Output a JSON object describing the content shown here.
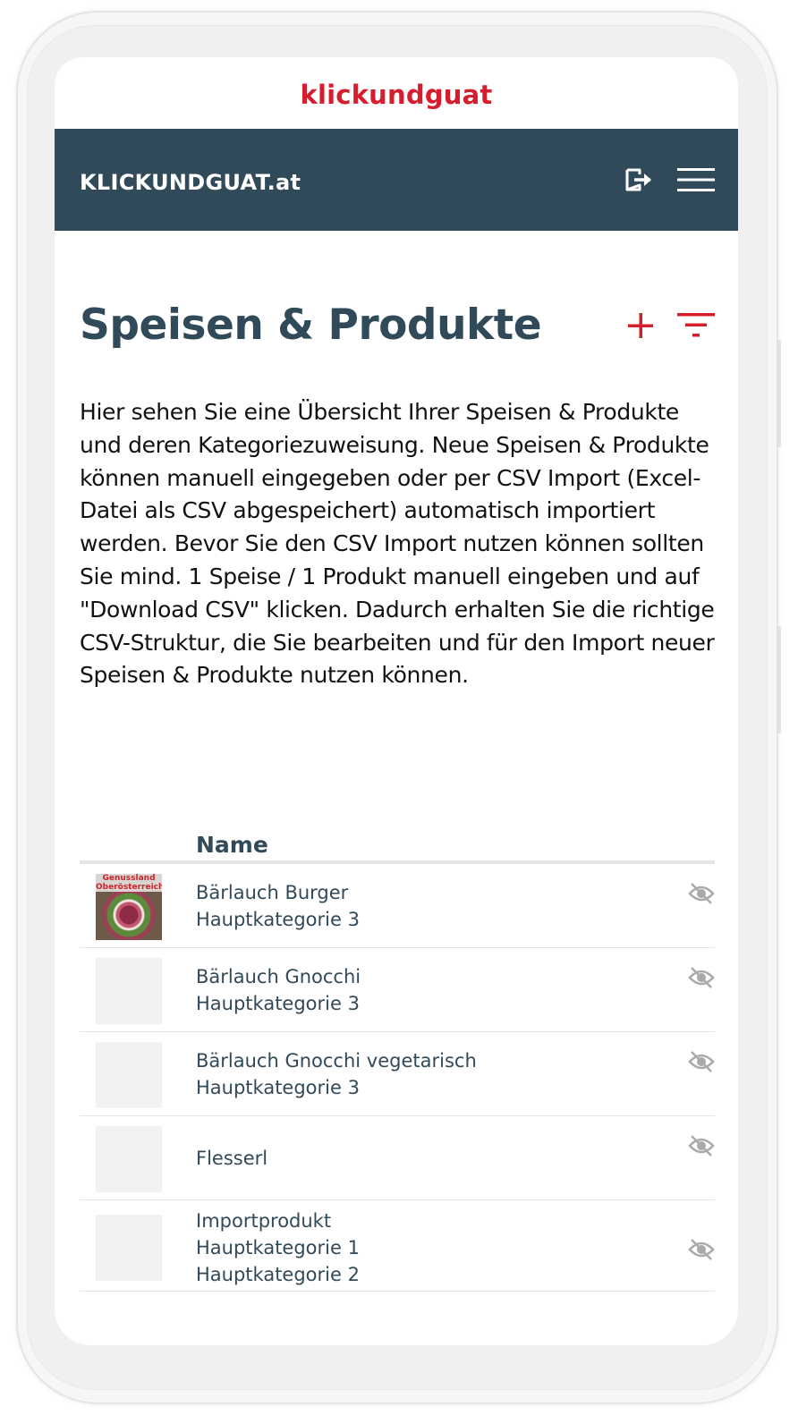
{
  "app": {
    "logo": "klickundguat",
    "brand": "KLICKUNDGUAT.at"
  },
  "header": {
    "icons": [
      "logout-icon",
      "hamburger-menu-icon"
    ]
  },
  "page": {
    "title": "Speisen & Produkte",
    "intro": "Hier sehen Sie eine Übersicht Ihrer Speisen & Produkte und deren Kategoriezuweisung. Neue Speisen & Produkte können manuell eingegeben oder per CSV Import (Excel-Datei als CSV abgespeichert) automatisch importiert werden. Bevor Sie den CSV Import nutzen können sollten Sie mind. 1 Speise / 1 Produkt manuell eingeben und auf \"Download CSV\" klicken. Dadurch erhalten Sie die richtige CSV-Struktur, die Sie bearbeiten und für den Import neuer Speisen & Produkte nutzen können."
  },
  "table": {
    "column_name": "Name",
    "rows": [
      {
        "name": "Bärlauch Burger",
        "categories": [
          "Hauptkategorie 3"
        ],
        "thumb_label": "Genussland Oberösterreich",
        "has_image": true
      },
      {
        "name": "Bärlauch Gnocchi",
        "categories": [
          "Hauptkategorie 3"
        ],
        "has_image": false
      },
      {
        "name": "Bärlauch Gnocchi vegetarisch",
        "categories": [
          "Hauptkategorie 3"
        ],
        "has_image": false
      },
      {
        "name": "Flesserl",
        "categories": [],
        "has_image": false
      },
      {
        "name": "Importprodukt",
        "categories": [
          "Hauptkategorie 1",
          "Hauptkategorie 2"
        ],
        "has_image": false
      }
    ]
  },
  "colors": {
    "accent": "#d51d2d",
    "navbar": "#314a59",
    "text_dark": "#314a59",
    "icon_gray": "#a9a9a9"
  }
}
